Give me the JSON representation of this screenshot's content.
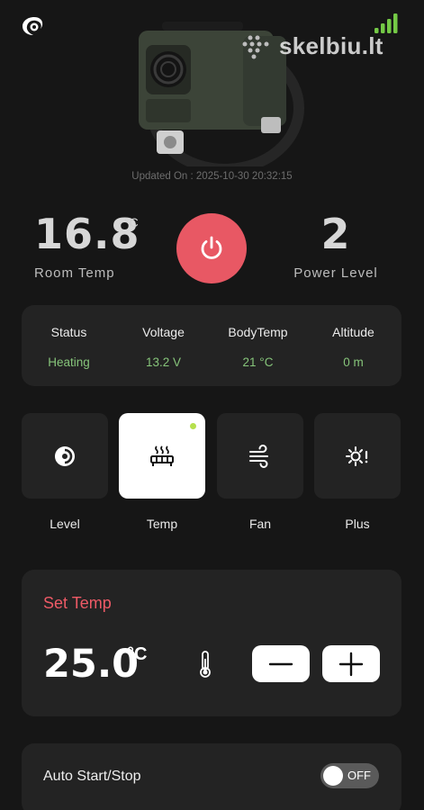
{
  "header": {
    "logo_icon": "swirl-logo-icon",
    "signal_icon": "signal-bars-icon",
    "signal_color": "#74c946",
    "watermark": "skelbiu.lt"
  },
  "device": {
    "image": "diesel-heater-device-image",
    "updated": "Updated On : 2025-10-30 20:32:15"
  },
  "room": {
    "value": "16.8",
    "unit": "°C",
    "label": "Room Temp"
  },
  "power": {
    "icon": "power-icon",
    "color": "#e85864"
  },
  "power_level": {
    "value": "2",
    "label": "Power Level"
  },
  "status": {
    "columns": [
      {
        "header": "Status",
        "value": "Heating"
      },
      {
        "header": "Voltage",
        "value": "13.2 V"
      },
      {
        "header": "BodyTemp",
        "value": "21 °C"
      },
      {
        "header": "Altitude",
        "value": "0 m"
      }
    ],
    "value_color": "#86c47a"
  },
  "modes": [
    {
      "label": "Level",
      "icon": "level-icon",
      "active": false
    },
    {
      "label": "Temp",
      "icon": "heater-icon",
      "active": true
    },
    {
      "label": "Fan",
      "icon": "wind-icon",
      "active": false
    },
    {
      "label": "Plus",
      "icon": "plus-mode-icon",
      "active": false
    }
  ],
  "set_temp": {
    "title": "Set Temp",
    "value": "25.0",
    "unit": "°C",
    "thermometer_icon": "thermometer-icon",
    "minus_icon": "minus-icon",
    "plus_icon": "plus-icon",
    "title_color": "#ee5a66"
  },
  "auto": {
    "label": "Auto Start/Stop",
    "toggle_state": "OFF"
  }
}
